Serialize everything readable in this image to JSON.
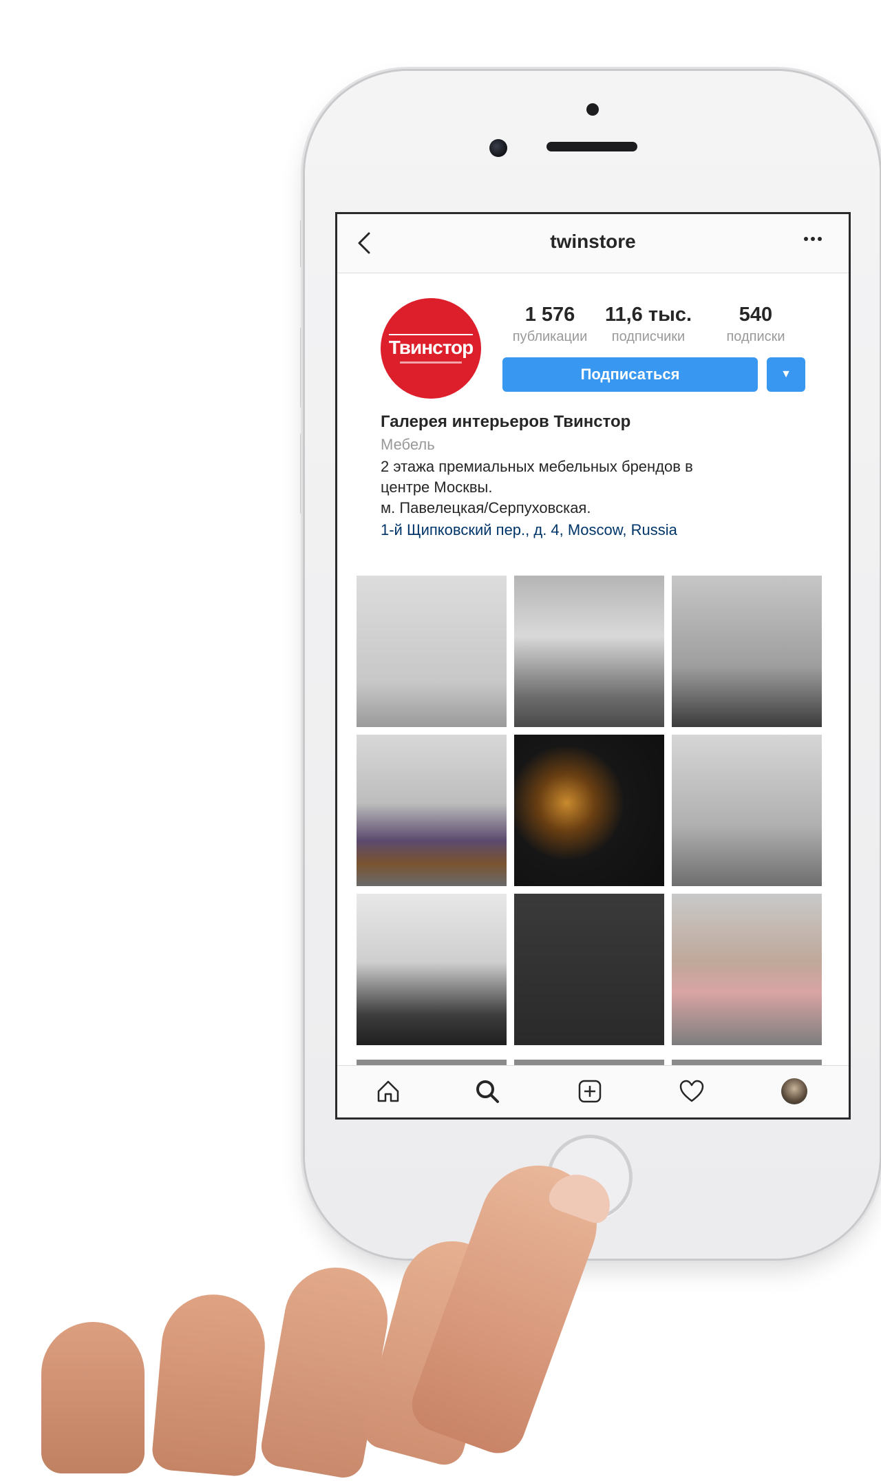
{
  "nav": {
    "back_icon": "chevron-left-icon",
    "title": "twinstore",
    "more_icon": "ellipsis-icon"
  },
  "profile": {
    "avatar_text": "Твинстор",
    "stats": [
      {
        "value": "1 576",
        "label": "публикации"
      },
      {
        "value": "11,6 тыс.",
        "label": "подписчики"
      },
      {
        "value": "540",
        "label": "подписки"
      }
    ],
    "follow_label": "Подписаться",
    "dropdown_icon": "caret-down-icon"
  },
  "bio": {
    "name": "Галерея интерьеров Твинстор",
    "category": "Мебель",
    "line1": "2 этажа премиальных мебельных брендов в",
    "line2": "центре Москвы.",
    "line3": "м. Павелецкая/Серпуховская.",
    "location": "1-й Щипковский пер., д. 4, Moscow, Russia"
  },
  "tabbar": {
    "items": [
      "home-icon",
      "search-icon",
      "add-post-icon",
      "heart-icon",
      "profile-avatar"
    ]
  },
  "colors": {
    "accent": "#3897f0",
    "brand_red": "#dd1f2b",
    "link": "#003569"
  }
}
